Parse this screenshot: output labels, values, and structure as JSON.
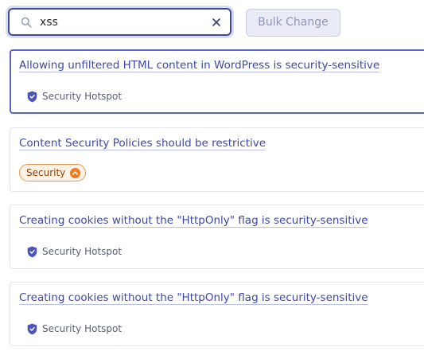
{
  "search": {
    "value": "xss",
    "icon": "search-icon",
    "clear_icon": "close-icon"
  },
  "toolbar": {
    "bulk_change_label": "Bulk Change"
  },
  "rules": [
    {
      "title": "Allowing unfiltered HTML content in WordPress is security-sensitive",
      "type_label": "Security Hotspot",
      "type_icon": "shield-icon",
      "selected": true
    },
    {
      "title": "Content Security Policies should be restrictive",
      "type_label": "Security",
      "severity_icon": "chevron-up-icon",
      "selected": false
    },
    {
      "title": "Creating cookies without the \"HttpOnly\" flag is security-sensitive",
      "type_label": "Security Hotspot",
      "type_icon": "shield-icon",
      "selected": false
    },
    {
      "title": "Creating cookies without the \"HttpOnly\" flag is security-sensitive",
      "type_label": "Security Hotspot",
      "type_icon": "shield-icon",
      "selected": false
    }
  ],
  "colors": {
    "accent": "#3e4a9c",
    "link": "#3d48a8",
    "security_badge_border": "#e8974f",
    "security_badge_bg": "#fff2e6"
  }
}
